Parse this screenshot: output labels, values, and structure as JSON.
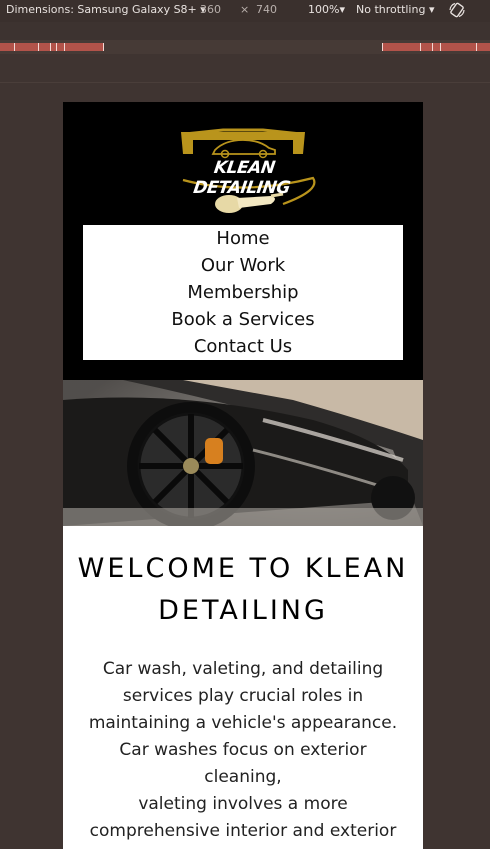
{
  "devtools": {
    "dimensions_label": "Dimensions: Samsung Galaxy S8+ ▾",
    "width_value": "360",
    "times": "×",
    "height_value": "740",
    "zoom": "100%▾",
    "throttling": "No throttling ▾",
    "rotate_icon": "rotate-icon"
  },
  "site": {
    "logo_text": "KLEAN DETAILING",
    "nav": [
      "Home",
      "Our Work",
      "Membership",
      "Book a Services",
      "Contact Us"
    ],
    "welcome_title": "WELCOME TO KLEAN DETAILING",
    "body_lines": [
      "Car wash, valeting, and detailing",
      "services play crucial roles in",
      "maintaining a vehicle's appearance.",
      "Car washes focus on exterior",
      "cleaning,",
      "valeting involves a more",
      "comprehensive interior and exterior"
    ]
  },
  "colors": {
    "logo_gold": "#b9941c",
    "devtools_bg": "#3a302d",
    "breakpoint_red": "#b2534a"
  }
}
